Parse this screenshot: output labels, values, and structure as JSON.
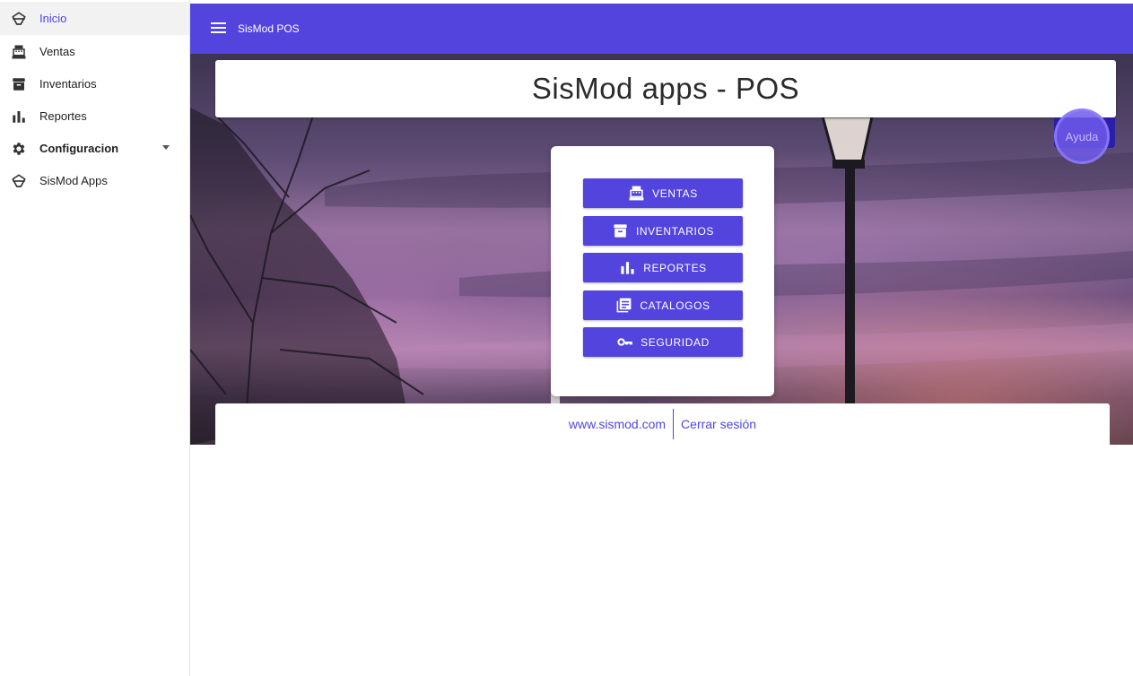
{
  "sidebar": {
    "items": [
      {
        "label": "Inicio",
        "icon": "sismod-logo-icon",
        "active": true
      },
      {
        "label": "Ventas",
        "icon": "cash-register-icon"
      },
      {
        "label": "Inventarios",
        "icon": "archive-box-icon"
      },
      {
        "label": "Reportes",
        "icon": "bar-chart-icon"
      },
      {
        "label": "Configuracion",
        "icon": "gear-icon",
        "expandable": true
      },
      {
        "label": "SisMod Apps",
        "icon": "sismod-logo-icon"
      }
    ]
  },
  "topbar": {
    "title": "SisMod POS",
    "menu_icon": "hamburger-menu-icon",
    "color": "#5244dc"
  },
  "main": {
    "title": "SisMod apps - POS",
    "help_label": "Ayuda",
    "buttons": [
      {
        "label": "VENTAS",
        "icon": "cash-register-icon"
      },
      {
        "label": "INVENTARIOS",
        "icon": "archive-box-icon"
      },
      {
        "label": "REPORTES",
        "icon": "bar-chart-icon"
      },
      {
        "label": "CATALOGOS",
        "icon": "library-books-icon"
      },
      {
        "label": "SEGURIDAD",
        "icon": "key-icon"
      }
    ],
    "footer": {
      "website": "www.sismod.com",
      "logout": "Cerrar sesión"
    }
  },
  "colors": {
    "accent": "#5244dc",
    "active_text": "#4f46e5"
  }
}
